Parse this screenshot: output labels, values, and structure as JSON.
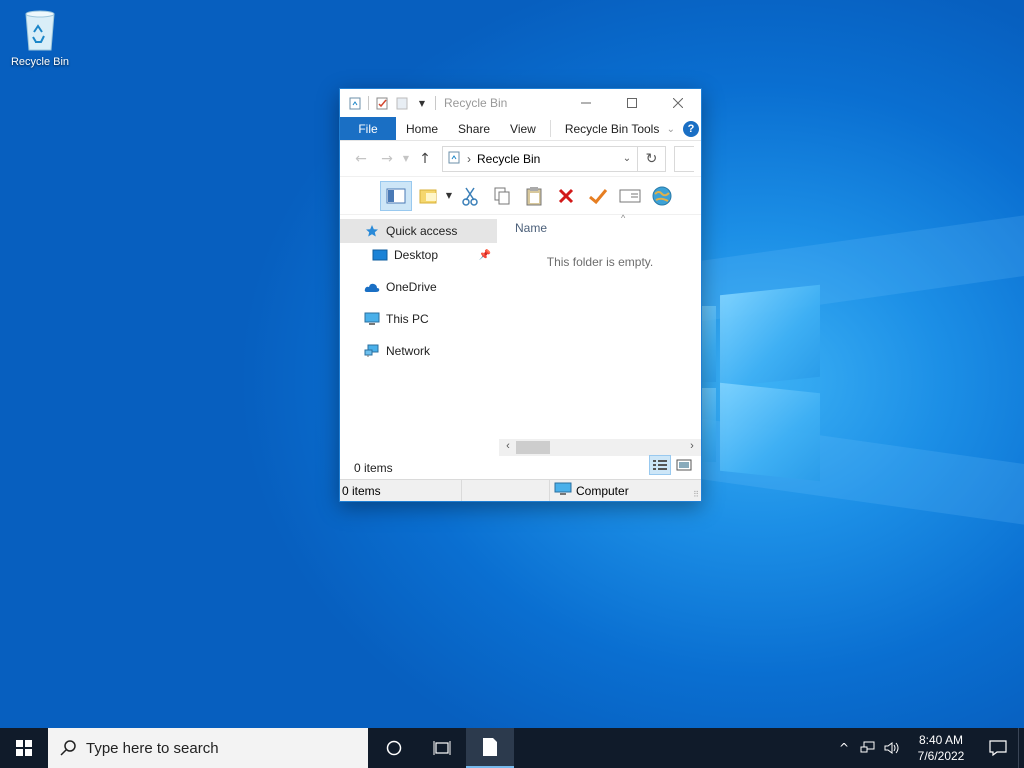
{
  "desktop": {
    "icons": [
      {
        "label": "Recycle Bin",
        "icon": "recycle-bin-icon"
      }
    ]
  },
  "window": {
    "title": "Recycle Bin",
    "ribbon_tabs": [
      {
        "label": "File"
      },
      {
        "label": "Home"
      },
      {
        "label": "Share"
      },
      {
        "label": "View"
      },
      {
        "label": "Recycle Bin Tools"
      }
    ],
    "address": {
      "location": "Recycle Bin"
    },
    "nav_pane": [
      {
        "label": "Quick access",
        "icon": "star-icon",
        "selected": true
      },
      {
        "label": "Desktop",
        "icon": "desktop-icon",
        "pinned": true
      },
      {
        "label": "OneDrive",
        "icon": "cloud-icon"
      },
      {
        "label": "This PC",
        "icon": "computer-icon"
      },
      {
        "label": "Network",
        "icon": "network-icon"
      }
    ],
    "file_pane": {
      "column_header": "Name",
      "empty_message": "This folder is empty."
    },
    "items_count": "0 items",
    "status_bar": {
      "left": "0 items",
      "right": "Computer"
    }
  },
  "taskbar": {
    "search_placeholder": "Type here to search",
    "clock_time": "8:40 AM",
    "clock_date": "7/6/2022"
  },
  "colors": {
    "accent": "#1a6fc4",
    "taskbar": "#101b2a",
    "desktop": "#0a6fd1"
  }
}
